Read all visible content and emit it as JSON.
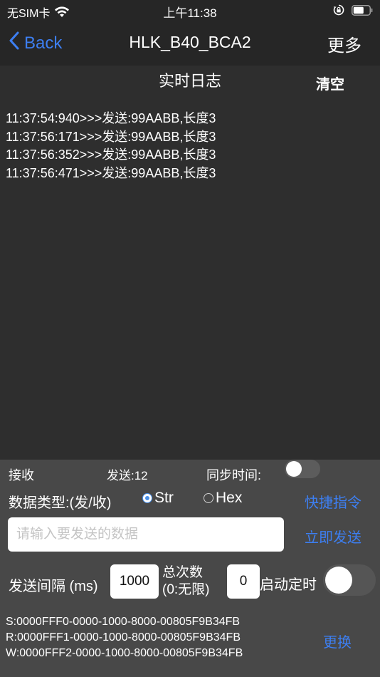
{
  "status_bar": {
    "carrier": "无SIM卡",
    "time": "上午11:38"
  },
  "nav": {
    "back_label": "Back",
    "title": "HLK_B40_BCA2",
    "more_label": "更多"
  },
  "log": {
    "title": "实时日志",
    "clear_label": "清空",
    "entries": [
      "11:37:54:940>>>发送:99AABB,长度3",
      "11:37:56:171>>>发送:99AABB,长度3",
      "11:37:56:352>>>发送:99AABB,长度3",
      "11:37:56:471>>>发送:99AABB,长度3"
    ]
  },
  "controls": {
    "receive_label": "接收",
    "send_count_label": "发送:12",
    "sync_time_label": "同步时间:",
    "sync_time_on": false,
    "data_type_label": "数据类型:(发/收)",
    "type_options": [
      "Str",
      "Hex"
    ],
    "type_selected": "Str",
    "shortcut_label": "快捷指令",
    "send_placeholder": "请输入要发送的数据",
    "send_value": "",
    "send_now_label": "立即发送",
    "interval_label": "发送间隔 (ms)",
    "interval_value": "1000",
    "total_label_line1": "总次数",
    "total_label_line2": "(0:无限)",
    "total_value": "0",
    "timer_label": "启动定时",
    "timer_on": false
  },
  "uuids": {
    "service": "S:0000FFF0-0000-1000-8000-00805F9B34FB",
    "read": "R:0000FFF1-0000-1000-8000-00805F9B34FB",
    "write": "W:0000FFF2-0000-1000-8000-00805F9B34FB",
    "change_label": "更换"
  },
  "colors": {
    "accent": "#3d7ff2",
    "bar_background": "#262626",
    "log_background": "#2e2e2e",
    "panel_background": "#484848"
  },
  "icons": {
    "wifi": "wifi-icon",
    "orientation_lock": "orientation-lock-icon",
    "battery": "battery-icon",
    "back": "chevron-left-icon"
  }
}
